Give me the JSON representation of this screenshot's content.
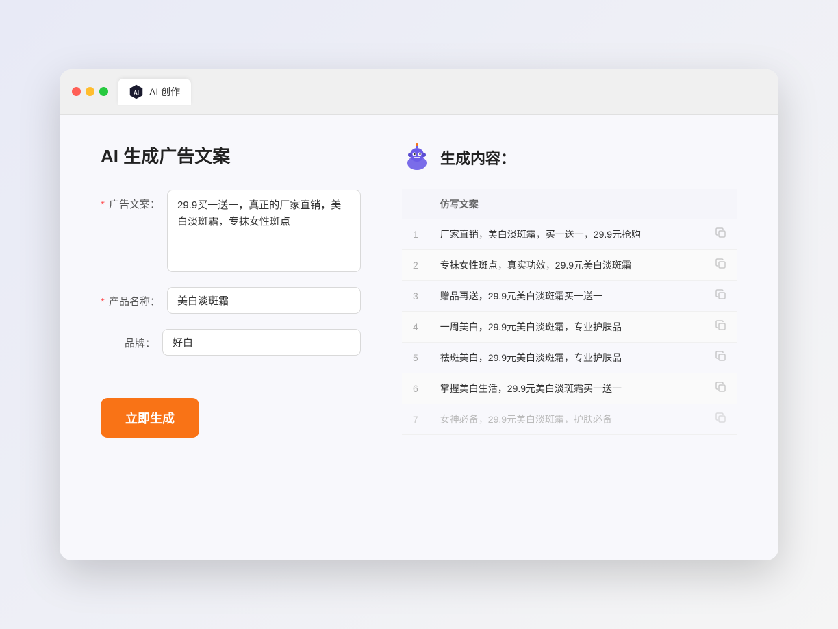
{
  "browser": {
    "tab_label": "AI 创作",
    "traffic_lights": [
      "red",
      "yellow",
      "green"
    ]
  },
  "left_panel": {
    "title": "AI 生成广告文案",
    "form": {
      "ad_copy": {
        "label": "广告文案：",
        "required": true,
        "value": "29.9买一送一，真正的厂家直销，美白淡斑霜，专抹女性斑点"
      },
      "product_name": {
        "label": "产品名称：",
        "required": true,
        "value": "美白淡斑霜"
      },
      "brand": {
        "label": "品牌：",
        "required": false,
        "value": "好白"
      }
    },
    "generate_button": "立即生成"
  },
  "right_panel": {
    "title": "生成内容：",
    "table_header": "仿写文案",
    "results": [
      {
        "num": 1,
        "text": "厂家直销，美白淡斑霜，买一送一，29.9元抢购"
      },
      {
        "num": 2,
        "text": "专抹女性斑点，真实功效，29.9元美白淡斑霜"
      },
      {
        "num": 3,
        "text": "赠品再送，29.9元美白淡斑霜买一送一"
      },
      {
        "num": 4,
        "text": "一周美白，29.9元美白淡斑霜，专业护肤品"
      },
      {
        "num": 5,
        "text": "祛斑美白，29.9元美白淡斑霜，专业护肤品"
      },
      {
        "num": 6,
        "text": "掌握美白生活，29.9元美白淡斑霜买一送一"
      },
      {
        "num": 7,
        "text": "女神必备，29.9元美白淡斑霜，护肤必备",
        "faded": true
      }
    ]
  }
}
